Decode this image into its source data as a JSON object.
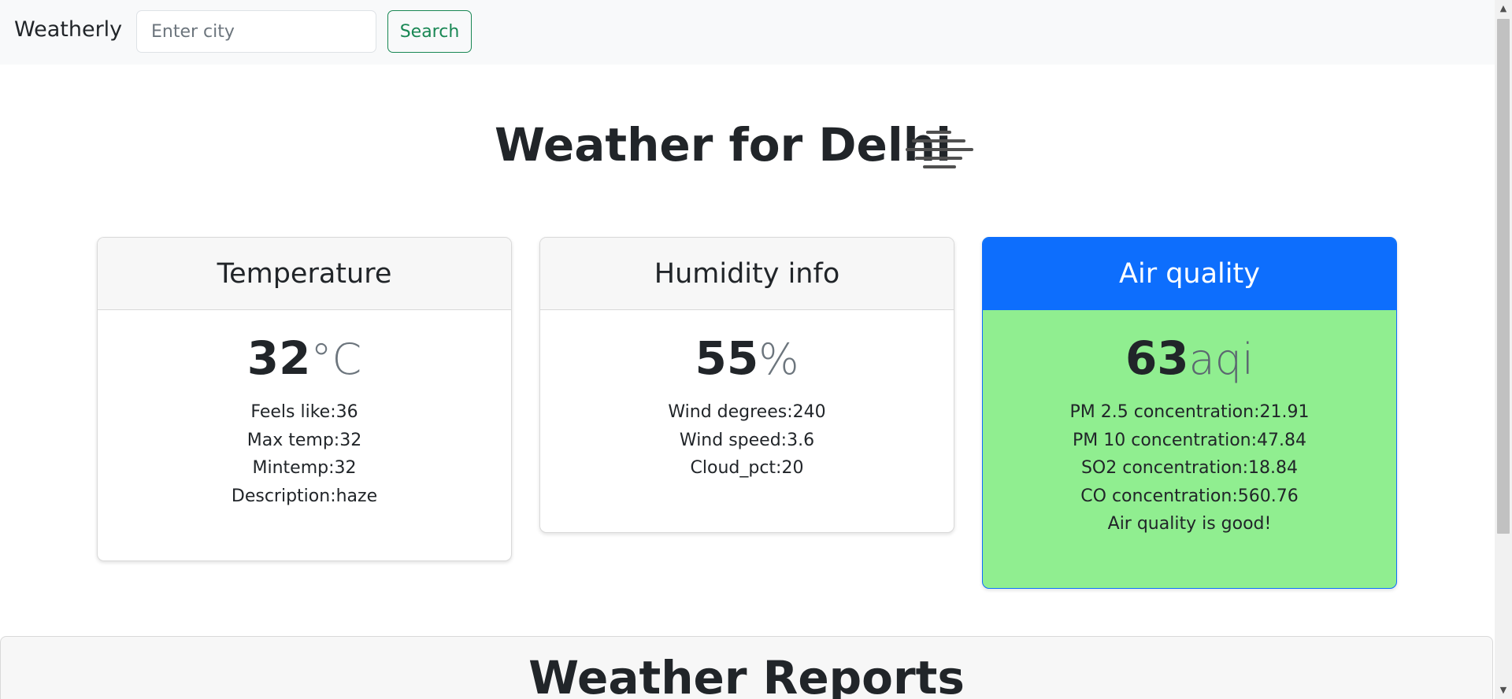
{
  "navbar": {
    "brand": "Weatherly",
    "search_placeholder": "Enter city",
    "search_value": "",
    "search_button": "Search"
  },
  "heading": {
    "title": "Weather for Delhi",
    "icon": "haze-icon"
  },
  "cards": {
    "temperature": {
      "header": "Temperature",
      "value": "32",
      "unit": "°C",
      "lines": [
        "Feels like:36",
        "Max temp:32",
        "Mintemp:32",
        "Description:haze"
      ]
    },
    "humidity": {
      "header": "Humidity info",
      "value": "55",
      "unit": "%",
      "lines": [
        "Wind degrees:240",
        "Wind speed:3.6",
        "Cloud_pct:20"
      ]
    },
    "air_quality": {
      "header": "Air quality",
      "value": "63",
      "unit": "aqi",
      "lines": [
        "PM 2.5 concentration:21.91",
        "PM 10 concentration:47.84",
        "SO2 concentration:18.84",
        "CO concentration:560.76",
        "Air quality is good!"
      ],
      "header_color": "#0d6efd",
      "body_color": "#90ee90"
    }
  },
  "reports": {
    "title": "Weather Reports"
  },
  "colors": {
    "navbar_bg": "#f8f9fa",
    "success": "#198754",
    "primary": "#0d6efd"
  }
}
